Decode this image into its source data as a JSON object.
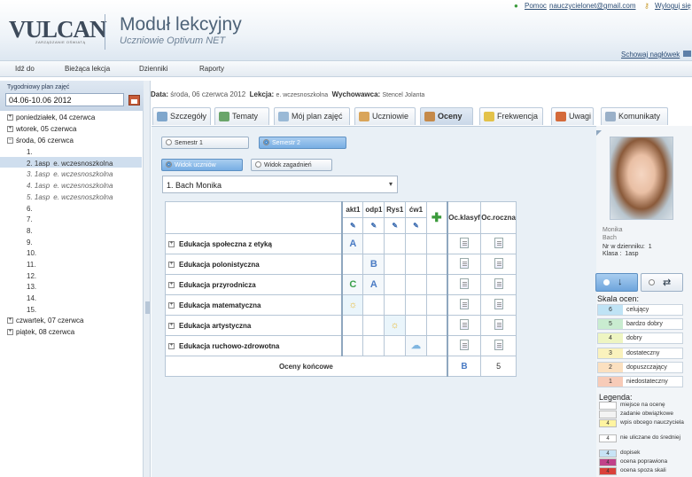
{
  "header": {
    "logo": "VULCAN",
    "logo_sub": "ZARZĄDZANIE OŚWIATĄ",
    "title": "Moduł lekcyjny",
    "subtitle": "Uczniowie Optivum NET",
    "help_label": "Pomoc",
    "user_email": "nauczycielonet@gmail.com",
    "logout_label": "Wyloguj się",
    "hide_header_label": "Schowaj nagłówek"
  },
  "menu": [
    "Idź do",
    "Bieżąca lekcja",
    "Dzienniki",
    "Raporty"
  ],
  "left_panel": {
    "week_label": "Tygodniowy plan zajęć",
    "week_value": "04.06-10.06 2012",
    "days": [
      {
        "label": "poniedziałek, 04 czerwca",
        "sign": "+"
      },
      {
        "label": "wtorek, 05 czerwca",
        "sign": "+"
      },
      {
        "label": "środa, 06 czerwca",
        "sign": "−"
      }
    ],
    "lessons": [
      {
        "num": "1.",
        "text": ""
      },
      {
        "num": "2. 1asp",
        "text": "e. wczesnoszkolna"
      },
      {
        "num": "3. 1asp",
        "text": "e. wczesnoszkolna"
      },
      {
        "num": "4. 1asp",
        "text": "e. wczesnoszkolna"
      },
      {
        "num": "5. 1asp",
        "text": "e. wczesnoszkolna"
      },
      {
        "num": "6.",
        "text": ""
      },
      {
        "num": "7.",
        "text": ""
      },
      {
        "num": "8.",
        "text": ""
      },
      {
        "num": "9.",
        "text": ""
      },
      {
        "num": "10.",
        "text": ""
      },
      {
        "num": "11.",
        "text": ""
      },
      {
        "num": "12.",
        "text": ""
      },
      {
        "num": "13.",
        "text": ""
      },
      {
        "num": "14.",
        "text": ""
      },
      {
        "num": "15.",
        "text": ""
      }
    ],
    "days_after": [
      {
        "label": "czwartek, 07 czerwca",
        "sign": "+"
      },
      {
        "label": "piątek, 08 czerwca",
        "sign": "+"
      }
    ]
  },
  "info": {
    "data_label": "Data:",
    "data_value": "środa, 06 czerwca 2012",
    "lekcja_label": "Lekcja:",
    "lekcja_value": "e. wczesnoszkolna",
    "wych_label": "Wychowawca:",
    "wych_value": "Stencel Jolanta"
  },
  "tabs": [
    "Szczegóły",
    "Tematy",
    "Mój plan zajęć",
    "Uczniowie",
    "Oceny",
    "Frekwencja",
    "Uwagi",
    "Komunikaty"
  ],
  "grades": {
    "semester1": "Semestr 1",
    "semester2": "Semestr 2",
    "view_students": "Widok uczniów",
    "view_topics": "Widok zagadnień",
    "student": "1. Bach Monika",
    "columns": [
      "akt1",
      "odp1",
      "Rys1",
      "ćw1"
    ],
    "col_klasyf": "Oc.klasyf",
    "col_roczna": "Oc.roczna",
    "subjects": [
      {
        "name": "Edukacja społeczna z etyką",
        "marks": [
          "A",
          "",
          "",
          ""
        ]
      },
      {
        "name": "Edukacja polonistyczna",
        "marks": [
          "",
          "B",
          "",
          ""
        ]
      },
      {
        "name": "Edukacja przyrodnicza",
        "marks": [
          "C",
          "A",
          "",
          ""
        ]
      },
      {
        "name": "Edukacja matematyczna",
        "marks": [
          "☼",
          "",
          "",
          ""
        ]
      },
      {
        "name": "Edukacja artystyczna",
        "marks": [
          "",
          "",
          "☼",
          ""
        ]
      },
      {
        "name": "Edukacja ruchowo-zdrowotna",
        "marks": [
          "",
          "",
          "",
          "☁"
        ]
      }
    ],
    "final_label": "Oceny końcowe",
    "final_klasyf": "B",
    "final_roczna": "5"
  },
  "student_info": {
    "first_name": "Monika",
    "last_name": "Bach",
    "nr_label": "Nr w dzienniku:",
    "nr_value": "1",
    "klasa_label": "Klasa :",
    "klasa_value": "1asp"
  },
  "scale": {
    "title": "Skala ocen:",
    "items": [
      {
        "n": "6",
        "label": "celujący",
        "color": "#bfe3f5"
      },
      {
        "n": "5",
        "label": "bardzo dobry",
        "color": "#c9ecd0"
      },
      {
        "n": "4",
        "label": "dobry",
        "color": "#eef5c2"
      },
      {
        "n": "3",
        "label": "dostateczny",
        "color": "#faf2bd"
      },
      {
        "n": "2",
        "label": "dopuszczający",
        "color": "#fbe0c0"
      },
      {
        "n": "1",
        "label": "niedostateczny",
        "color": "#f7cbb8"
      }
    ]
  },
  "legend": {
    "title": "Legenda:",
    "items": [
      {
        "box": "",
        "label": "miejsce na ocenę",
        "color": "#ffffff"
      },
      {
        "box": "",
        "label": "zadanie obwiązkowe",
        "color": "#f3f3f3"
      },
      {
        "box": "4",
        "label": "wpis obcego nauczyciela",
        "color": "#fff4a0"
      },
      {
        "box": "4",
        "label": "nie uliczane do średniej",
        "color": "#ffffff"
      },
      {
        "box": "4",
        "label": "dopisek",
        "color": "#c7e3f6"
      },
      {
        "box": "4",
        "label": "ocena poprawiona",
        "color": "#c1428a"
      },
      {
        "box": "4",
        "label": "ocena spoza skali",
        "color": "#d9413a"
      }
    ]
  }
}
